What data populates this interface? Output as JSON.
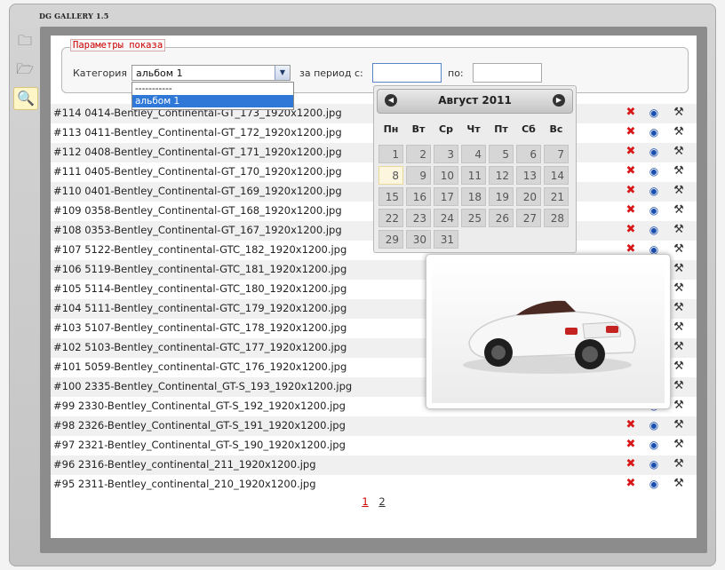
{
  "app": {
    "title": "DG GALLERY 1.5"
  },
  "filter": {
    "legend": "Параметры показа",
    "category_label": "Категория",
    "category_value": "альбом 1",
    "category_options": [
      "-----------",
      "альбом 1"
    ],
    "period_label": "за период с:",
    "to_label": "по:",
    "date_from": "",
    "date_to": ""
  },
  "calendar": {
    "title": "Август 2011",
    "weekdays": [
      "Пн",
      "Вт",
      "Ср",
      "Чт",
      "Пт",
      "Сб",
      "Вс"
    ],
    "weeks": [
      [
        "1",
        "2",
        "3",
        "4",
        "5",
        "6",
        "7"
      ],
      [
        "8",
        "9",
        "10",
        "11",
        "12",
        "13",
        "14"
      ],
      [
        "15",
        "16",
        "17",
        "18",
        "19",
        "20",
        "21"
      ],
      [
        "22",
        "23",
        "24",
        "25",
        "26",
        "27",
        "28"
      ],
      [
        "29",
        "30",
        "31",
        "",
        "",
        "",
        ""
      ]
    ],
    "today": "8"
  },
  "files": [
    "#114 0414-Bentley_Continental-GT_173_1920x1200.jpg",
    "#113 0411-Bentley_Continental-GT_172_1920x1200.jpg",
    "#112 0408-Bentley_Continental-GT_171_1920x1200.jpg",
    "#111 0405-Bentley_Continental-GT_170_1920x1200.jpg",
    "#110 0401-Bentley_Continental-GT_169_1920x1200.jpg",
    "#109 0358-Bentley_Continental-GT_168_1920x1200.jpg",
    "#108 0353-Bentley_Continental-GT_167_1920x1200.jpg",
    "#107 5122-Bentley_continental-GTC_182_1920x1200.jpg",
    "#106 5119-Bentley_continental-GTC_181_1920x1200.jpg",
    "#105 5114-Bentley_continental-GTC_180_1920x1200.jpg",
    "#104 5111-Bentley_continental-GTC_179_1920x1200.jpg",
    "#103 5107-Bentley_continental-GTC_178_1920x1200.jpg",
    "#102 5103-Bentley_continental-GTC_177_1920x1200.jpg",
    "#101 5059-Bentley_continental-GTC_176_1920x1200.jpg",
    "#100 2335-Bentley_Continental_GT-S_193_1920x1200.jpg",
    "#99 2330-Bentley_Continental_GT-S_192_1920x1200.jpg",
    "#98 2326-Bentley_Continental_GT-S_191_1920x1200.jpg",
    "#97 2321-Bentley_Continental_GT-S_190_1920x1200.jpg",
    "#96 2316-Bentley_continental_211_1920x1200.jpg",
    "#95 2311-Bentley_continental_210_1920x1200.jpg"
  ],
  "pager": {
    "pages": [
      "1",
      "2"
    ],
    "current": "1"
  },
  "icons": {
    "delete": "delete-x-icon",
    "view": "eye-icon",
    "edit": "tools-icon"
  },
  "colors": {
    "accent": "#cc0000",
    "selection": "#2f78d8",
    "panel": "#8c8c8c"
  }
}
